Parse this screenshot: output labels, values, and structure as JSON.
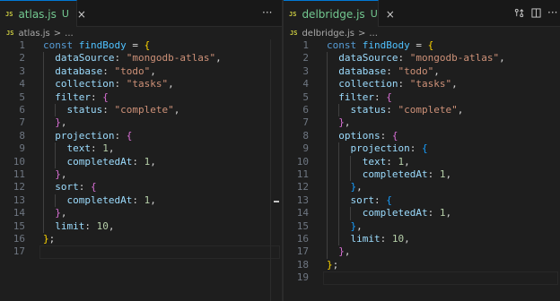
{
  "left": {
    "tab": {
      "lang": "JS",
      "name": "atlas.js",
      "status": "U",
      "close": "×"
    },
    "more": "···",
    "breadcrumb": {
      "lang": "JS",
      "file": "atlas.js",
      "sep": ">",
      "rest": "..."
    },
    "lines": [
      [
        [
          "k",
          "const "
        ],
        [
          "v",
          "findBody"
        ],
        [
          "t",
          " = "
        ],
        [
          "b1",
          "{"
        ]
      ],
      [
        [
          "t",
          "  "
        ],
        [
          "p",
          "dataSource"
        ],
        [
          "t",
          ": "
        ],
        [
          "s",
          "\"mongodb-atlas\""
        ],
        [
          "t",
          ","
        ]
      ],
      [
        [
          "t",
          "  "
        ],
        [
          "p",
          "database"
        ],
        [
          "t",
          ": "
        ],
        [
          "s",
          "\"todo\""
        ],
        [
          "t",
          ","
        ]
      ],
      [
        [
          "t",
          "  "
        ],
        [
          "p",
          "collection"
        ],
        [
          "t",
          ": "
        ],
        [
          "s",
          "\"tasks\""
        ],
        [
          "t",
          ","
        ]
      ],
      [
        [
          "t",
          "  "
        ],
        [
          "p",
          "filter"
        ],
        [
          "t",
          ": "
        ],
        [
          "b2",
          "{"
        ]
      ],
      [
        [
          "t",
          "    "
        ],
        [
          "p",
          "status"
        ],
        [
          "t",
          ": "
        ],
        [
          "s",
          "\"complete\""
        ],
        [
          "t",
          ","
        ]
      ],
      [
        [
          "t",
          "  "
        ],
        [
          "b2",
          "}"
        ],
        [
          "t",
          ","
        ]
      ],
      [
        [
          "t",
          "  "
        ],
        [
          "p",
          "projection"
        ],
        [
          "t",
          ": "
        ],
        [
          "b2",
          "{"
        ]
      ],
      [
        [
          "t",
          "    "
        ],
        [
          "p",
          "text"
        ],
        [
          "t",
          ": "
        ],
        [
          "n",
          "1"
        ],
        [
          "t",
          ","
        ]
      ],
      [
        [
          "t",
          "    "
        ],
        [
          "p",
          "completedAt"
        ],
        [
          "t",
          ": "
        ],
        [
          "n",
          "1"
        ],
        [
          "t",
          ","
        ]
      ],
      [
        [
          "t",
          "  "
        ],
        [
          "b2",
          "}"
        ],
        [
          "t",
          ","
        ]
      ],
      [
        [
          "t",
          "  "
        ],
        [
          "p",
          "sort"
        ],
        [
          "t",
          ": "
        ],
        [
          "b2",
          "{"
        ]
      ],
      [
        [
          "t",
          "    "
        ],
        [
          "p",
          "completedAt"
        ],
        [
          "t",
          ": "
        ],
        [
          "n",
          "1"
        ],
        [
          "t",
          ","
        ]
      ],
      [
        [
          "t",
          "  "
        ],
        [
          "b2",
          "}"
        ],
        [
          "t",
          ","
        ]
      ],
      [
        [
          "t",
          "  "
        ],
        [
          "p",
          "limit"
        ],
        [
          "t",
          ": "
        ],
        [
          "n",
          "10"
        ],
        [
          "t",
          ","
        ]
      ],
      [
        [
          "b1",
          "}"
        ],
        [
          "t",
          ";"
        ]
      ],
      []
    ]
  },
  "right": {
    "tab": {
      "lang": "JS",
      "name": "delbridge.js",
      "status": "U",
      "close": "×"
    },
    "more": "···",
    "breadcrumb": {
      "lang": "JS",
      "file": "delbridge.js",
      "sep": ">",
      "rest": "..."
    },
    "lines": [
      [
        [
          "k",
          "const "
        ],
        [
          "v",
          "findBody"
        ],
        [
          "t",
          " = "
        ],
        [
          "b1",
          "{"
        ]
      ],
      [
        [
          "t",
          "  "
        ],
        [
          "p",
          "dataSource"
        ],
        [
          "t",
          ": "
        ],
        [
          "s",
          "\"mongodb-atlas\""
        ],
        [
          "t",
          ","
        ]
      ],
      [
        [
          "t",
          "  "
        ],
        [
          "p",
          "database"
        ],
        [
          "t",
          ": "
        ],
        [
          "s",
          "\"todo\""
        ],
        [
          "t",
          ","
        ]
      ],
      [
        [
          "t",
          "  "
        ],
        [
          "p",
          "collection"
        ],
        [
          "t",
          ": "
        ],
        [
          "s",
          "\"tasks\""
        ],
        [
          "t",
          ","
        ]
      ],
      [
        [
          "t",
          "  "
        ],
        [
          "p",
          "filter"
        ],
        [
          "t",
          ": "
        ],
        [
          "b2",
          "{"
        ]
      ],
      [
        [
          "t",
          "    "
        ],
        [
          "p",
          "status"
        ],
        [
          "t",
          ": "
        ],
        [
          "s",
          "\"complete\""
        ],
        [
          "t",
          ","
        ]
      ],
      [
        [
          "t",
          "  "
        ],
        [
          "b2",
          "}"
        ],
        [
          "t",
          ","
        ]
      ],
      [
        [
          "t",
          "  "
        ],
        [
          "p",
          "options"
        ],
        [
          "t",
          ": "
        ],
        [
          "b2",
          "{"
        ]
      ],
      [
        [
          "t",
          "    "
        ],
        [
          "p",
          "projection"
        ],
        [
          "t",
          ": "
        ],
        [
          "b3",
          "{"
        ]
      ],
      [
        [
          "t",
          "      "
        ],
        [
          "p",
          "text"
        ],
        [
          "t",
          ": "
        ],
        [
          "n",
          "1"
        ],
        [
          "t",
          ","
        ]
      ],
      [
        [
          "t",
          "      "
        ],
        [
          "p",
          "completedAt"
        ],
        [
          "t",
          ": "
        ],
        [
          "n",
          "1"
        ],
        [
          "t",
          ","
        ]
      ],
      [
        [
          "t",
          "    "
        ],
        [
          "b3",
          "}"
        ],
        [
          "t",
          ","
        ]
      ],
      [
        [
          "t",
          "    "
        ],
        [
          "p",
          "sort"
        ],
        [
          "t",
          ": "
        ],
        [
          "b3",
          "{"
        ]
      ],
      [
        [
          "t",
          "      "
        ],
        [
          "p",
          "completedAt"
        ],
        [
          "t",
          ": "
        ],
        [
          "n",
          "1"
        ],
        [
          "t",
          ","
        ]
      ],
      [
        [
          "t",
          "    "
        ],
        [
          "b3",
          "}"
        ],
        [
          "t",
          ","
        ]
      ],
      [
        [
          "t",
          "    "
        ],
        [
          "p",
          "limit"
        ],
        [
          "t",
          ": "
        ],
        [
          "n",
          "10"
        ],
        [
          "t",
          ","
        ]
      ],
      [
        [
          "t",
          "  "
        ],
        [
          "b2",
          "}"
        ],
        [
          "t",
          ","
        ]
      ],
      [
        [
          "b1",
          "}"
        ],
        [
          "t",
          ";"
        ]
      ],
      []
    ]
  },
  "colors": {
    "accent": "#0078d4",
    "untracked": "#73c991",
    "js_badge": "#cbcb41"
  }
}
